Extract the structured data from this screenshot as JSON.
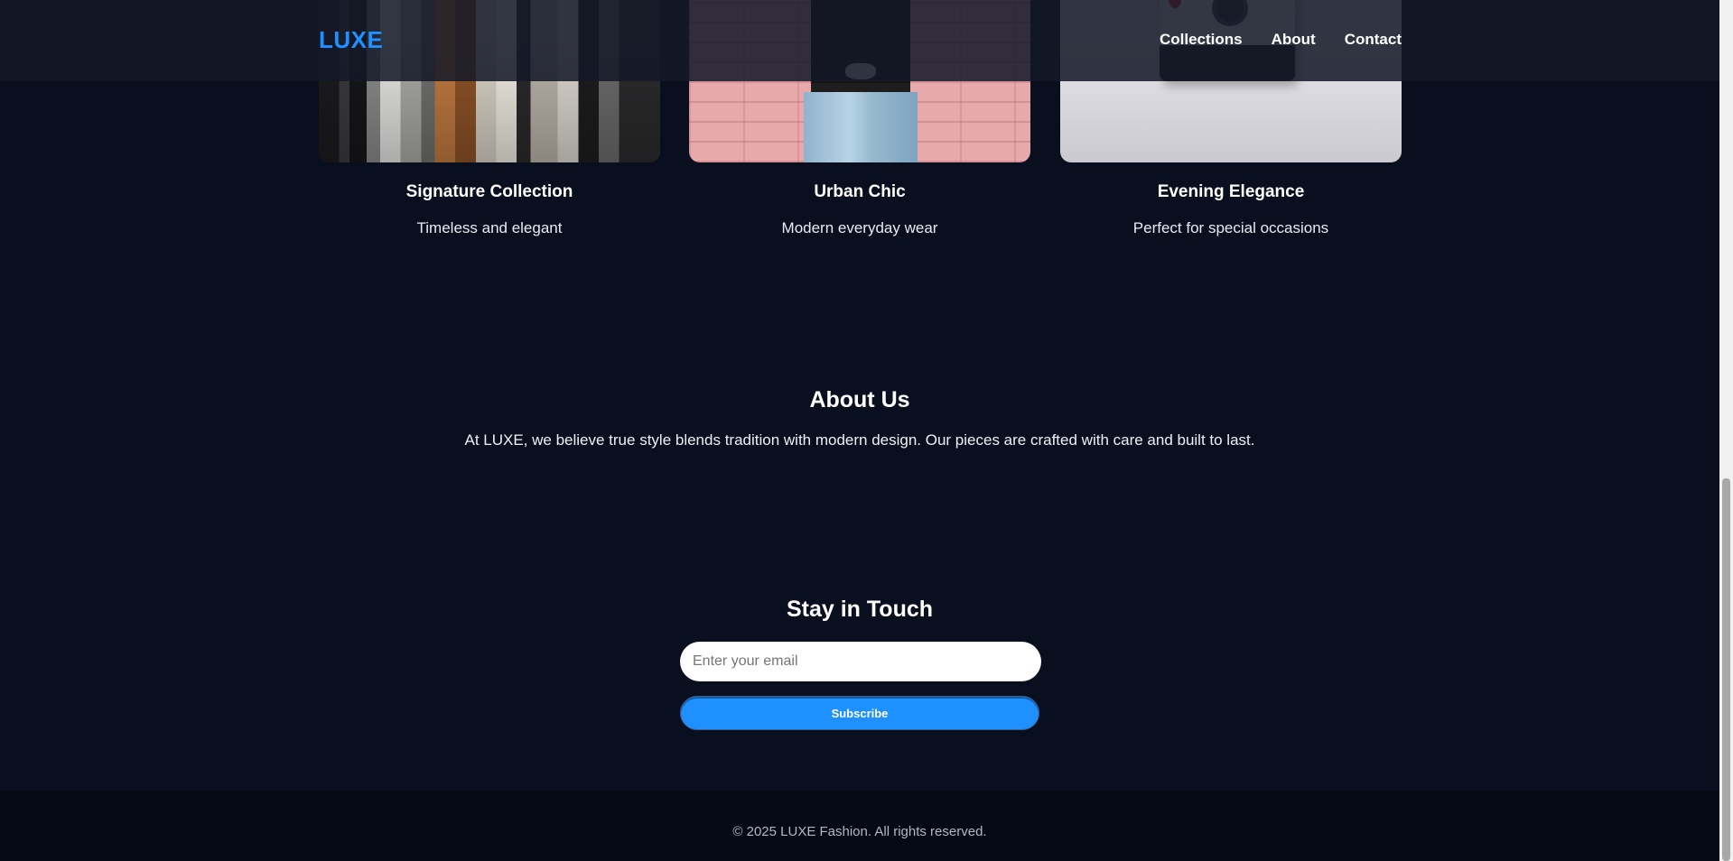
{
  "brand": {
    "logo": "LUXE",
    "accent": "#1e90ff"
  },
  "nav": {
    "items": [
      "Collections",
      "About",
      "Contact"
    ]
  },
  "collections": [
    {
      "title": "Signature Collection",
      "subtitle": "Timeless and elegant"
    },
    {
      "title": "Urban Chic",
      "subtitle": "Modern everyday wear"
    },
    {
      "title": "Evening Elegance",
      "subtitle": "Perfect for special occasions"
    }
  ],
  "about": {
    "title": "About Us",
    "text": "At LUXE, we believe true style blends tradition with modern design. Our pieces are crafted with care and built to last."
  },
  "newsletter": {
    "title": "Stay in Touch",
    "email_placeholder": "Enter your email",
    "email_value": "",
    "button_label": "Subscribe"
  },
  "footer": {
    "text": "© 2025 LUXE Fashion. All rights reserved."
  },
  "colors": {
    "background": "#0a0f1f",
    "header": "#141828",
    "footer": "#050913",
    "button": "#1e90ff"
  }
}
